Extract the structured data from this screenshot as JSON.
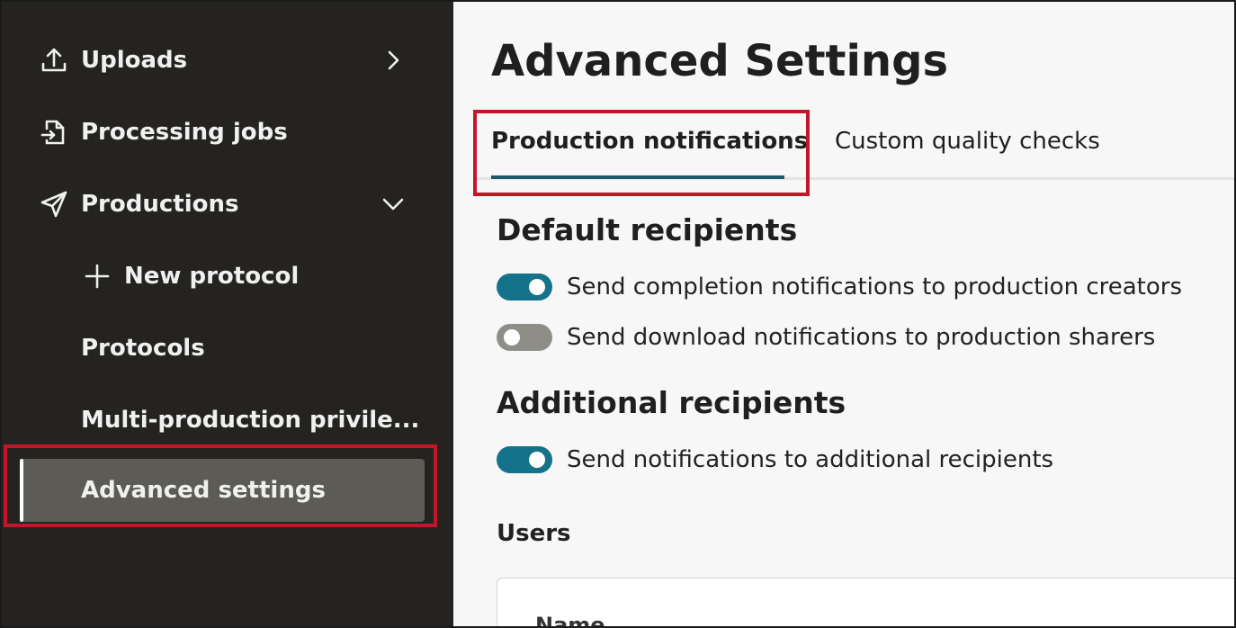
{
  "sidebar": {
    "items": [
      {
        "label": "Uploads",
        "icon": "upload-icon",
        "chevron": "chevron-right-icon"
      },
      {
        "label": "Processing jobs",
        "icon": "file-arrow-icon"
      },
      {
        "label": "Productions",
        "icon": "paper-plane-icon",
        "chevron": "chevron-down-icon"
      },
      {
        "label": "New protocol",
        "icon": "plus-icon"
      },
      {
        "label": "Protocols"
      },
      {
        "label": "Multi-production privile..."
      },
      {
        "label": "Advanced settings",
        "active": true
      }
    ]
  },
  "main": {
    "title": "Advanced Settings",
    "tabs": [
      {
        "label": "Production notifications",
        "active": true
      },
      {
        "label": "Custom quality checks",
        "active": false
      }
    ],
    "default_recipients": {
      "title": "Default recipients",
      "toggles": [
        {
          "label": "Send completion notifications to production creators",
          "on": true
        },
        {
          "label": "Send download notifications to production sharers",
          "on": false
        }
      ]
    },
    "additional_recipients": {
      "title": "Additional recipients",
      "toggles": [
        {
          "label": "Send notifications to additional recipients",
          "on": true
        }
      ]
    },
    "users": {
      "label": "Users",
      "columns": [
        "Name"
      ]
    }
  },
  "colors": {
    "sidebar_bg": "#242320",
    "active_item_bg": "#5c5b55",
    "accent": "#14738a",
    "tab_underline": "#1c5a6b",
    "highlight": "#c4162a"
  }
}
